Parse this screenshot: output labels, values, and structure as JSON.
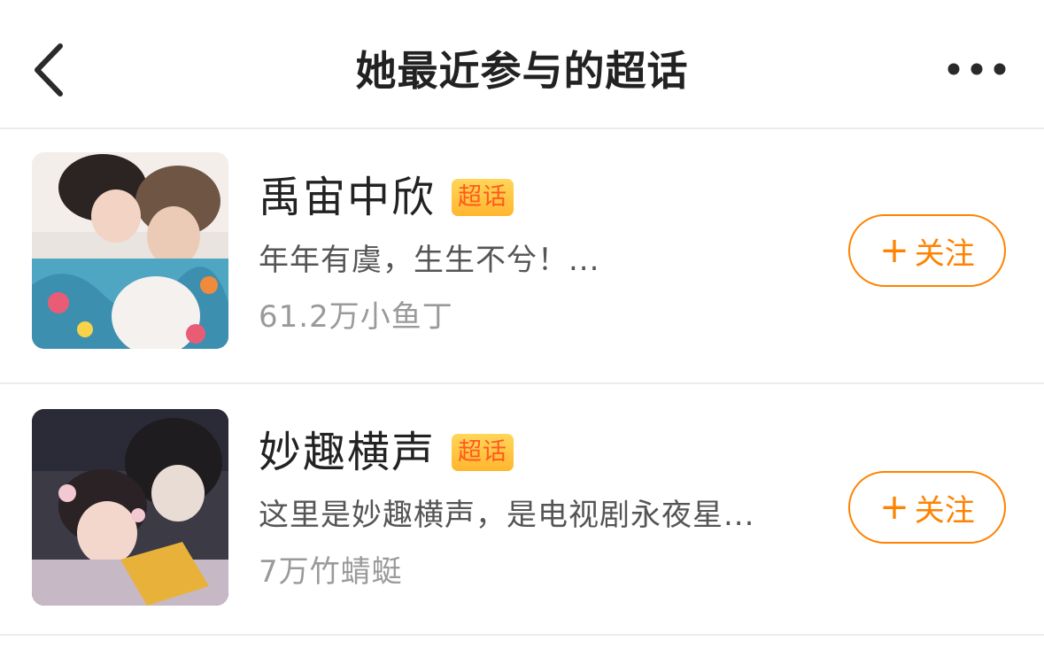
{
  "header": {
    "title": "她最近参与的超话",
    "back_icon": "chevron-left-icon",
    "more_icon": "more-horizontal-icon"
  },
  "badge_label": "超话",
  "follow_label": "关注",
  "follow_prefix": "+",
  "colors": {
    "accent": "#ff8200",
    "badge_bg": "#ffc63f",
    "badge_text": "#ff5a1f",
    "divider": "#ececec"
  },
  "topics": [
    {
      "name": "禹宙中欣",
      "description": "年年有虞，生生不兮！...",
      "followers": "61.2万小鱼丁"
    },
    {
      "name": "妙趣横声",
      "description": "这里是妙趣横声，是电视剧永夜星...",
      "followers": "7万竹蜻蜓"
    }
  ]
}
